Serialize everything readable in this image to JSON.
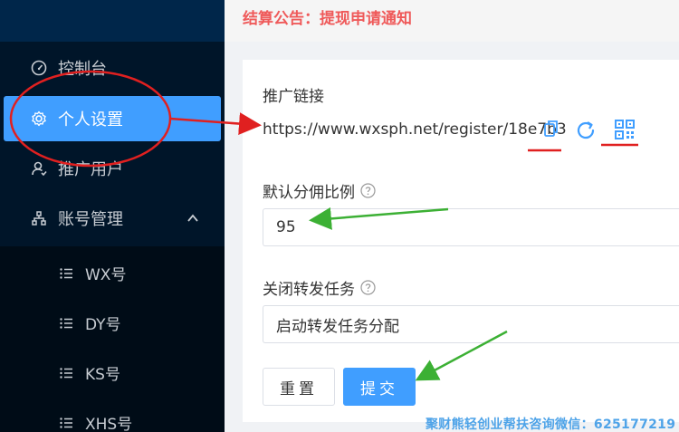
{
  "notice": {
    "text": "结算公告：提现申请通知"
  },
  "sidebar": {
    "items": [
      {
        "label": "控制台",
        "icon": "dashboard-icon"
      },
      {
        "label": "个人设置",
        "icon": "gear-icon",
        "active": true
      },
      {
        "label": "推广用户",
        "icon": "user-icon"
      },
      {
        "label": "账号管理",
        "icon": "org-icon",
        "expanded": true
      }
    ],
    "subitems": [
      {
        "label": "WX号",
        "icon": "list-icon"
      },
      {
        "label": "DY号",
        "icon": "list-icon"
      },
      {
        "label": "KS号",
        "icon": "list-icon"
      },
      {
        "label": "XHS号",
        "icon": "list-icon"
      }
    ]
  },
  "form": {
    "link_label": "推广链接",
    "link_value": "https://www.wxsph.net/register/18e7b3",
    "ratio_label": "默认分佣比例",
    "ratio_value": "95",
    "forward_label": "关闭转发任务",
    "forward_value": "启动转发任务分配",
    "reset_label": "重置",
    "submit_label": "提交"
  },
  "watermark": {
    "text": "聚财熊轻创业帮扶咨询微信：625177219"
  },
  "colors": {
    "sidebar_bg": "#001529",
    "accent": "#409eff",
    "notice_red": "#ef5a5a",
    "annotation_red": "#e02020",
    "annotation_green": "#3cb034"
  }
}
